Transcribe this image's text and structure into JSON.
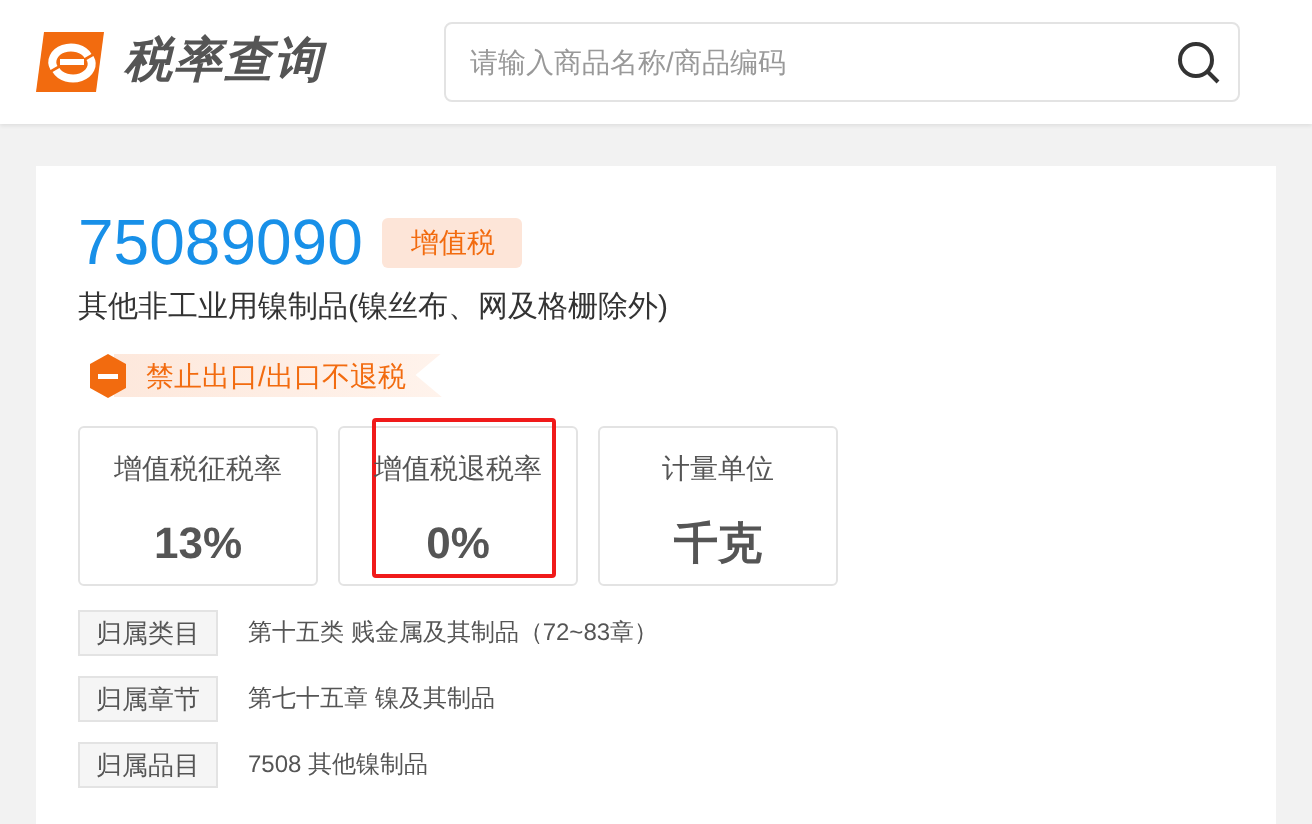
{
  "header": {
    "logo_text": "税率查询",
    "search": {
      "placeholder": "请输入商品名称/商品编码"
    }
  },
  "product": {
    "code": "75089090",
    "tag": "增值税",
    "name": "其他非工业用镍制品(镍丝布、网及格栅除外)",
    "notice": "禁止出口/出口不退税"
  },
  "stats": [
    {
      "label": "增值税征税率",
      "value": "13%",
      "highlighted": false
    },
    {
      "label": "增值税退税率",
      "value": "0%",
      "highlighted": true
    },
    {
      "label": "计量单位",
      "value": "千克",
      "highlighted": false
    }
  ],
  "details": [
    {
      "label": "归属类目",
      "value": "第十五类 贱金属及其制品（72~83章）"
    },
    {
      "label": "归属章节",
      "value": "第七十五章 镍及其制品"
    },
    {
      "label": "归属品目",
      "value": "7508 其他镍制品"
    }
  ]
}
